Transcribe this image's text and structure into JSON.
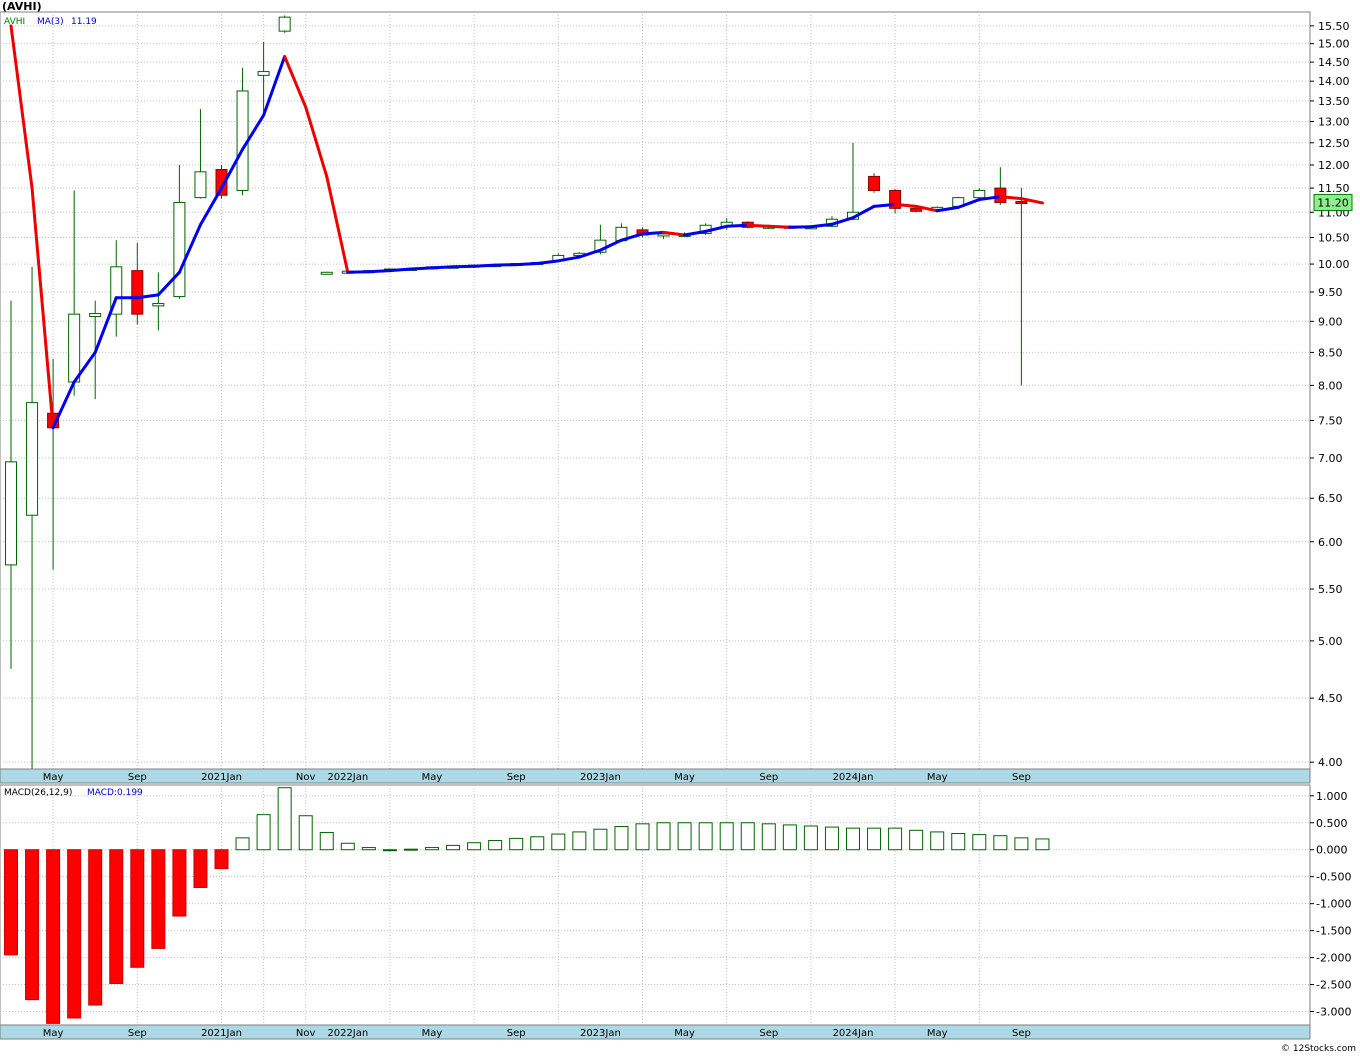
{
  "chart_data": [
    {
      "type": "candlestick",
      "title": "(AVHI)",
      "legend": [
        {
          "label": "AVHI",
          "color": "#008000"
        },
        {
          "label": "MA(3)",
          "color": "#0000cc"
        },
        {
          "label": "11.19",
          "color": "#0000cc"
        }
      ],
      "last_price": "11.20",
      "scale": "log",
      "ylim": [
        3.95,
        15.9
      ],
      "yticks": [
        "15.50",
        "15.00",
        "14.50",
        "14.00",
        "13.50",
        "13.00",
        "12.50",
        "12.00",
        "11.50",
        "11.00",
        "10.50",
        "10.00",
        "9.50",
        "9.00",
        "8.50",
        "8.00",
        "7.50",
        "7.00",
        "6.50",
        "6.00",
        "5.50",
        "5.00",
        "4.50",
        "4.00"
      ],
      "x_month_index_range": [
        -0.5,
        51.5
      ],
      "month_gridlines": [
        2,
        6,
        10,
        12,
        14,
        18,
        22,
        26,
        30,
        34,
        38,
        42,
        46
      ],
      "xtick_labels": [
        {
          "month": 2,
          "label": "May"
        },
        {
          "month": 6,
          "label": "Sep"
        },
        {
          "month": 10,
          "label": "2021Jan"
        },
        {
          "month": 14,
          "label": "Nov"
        },
        {
          "month": 16,
          "label": "2022Jan"
        },
        {
          "month": 20,
          "label": "May"
        },
        {
          "month": 24,
          "label": "Sep"
        },
        {
          "month": 28,
          "label": "2023Jan"
        },
        {
          "month": 32,
          "label": "May"
        },
        {
          "month": 36,
          "label": "Sep"
        },
        {
          "month": 40,
          "label": "2024Jan"
        },
        {
          "month": 44,
          "label": "May"
        },
        {
          "month": 48,
          "label": "Sep"
        }
      ],
      "candles": [
        {
          "m": 0,
          "o": 5.75,
          "h": 9.35,
          "l": 4.75,
          "c": 6.95
        },
        {
          "m": 1,
          "o": 6.3,
          "h": 9.95,
          "l": 3.95,
          "c": 7.75
        },
        {
          "m": 2,
          "o": 7.6,
          "h": 8.4,
          "l": 5.7,
          "c": 7.4
        },
        {
          "m": 3,
          "o": 8.05,
          "h": 11.45,
          "l": 7.85,
          "c": 9.12
        },
        {
          "m": 4,
          "o": 9.08,
          "h": 9.35,
          "l": 7.8,
          "c": 9.13
        },
        {
          "m": 5,
          "o": 9.12,
          "h": 10.45,
          "l": 8.75,
          "c": 9.95
        },
        {
          "m": 6,
          "o": 9.88,
          "h": 10.4,
          "l": 8.95,
          "c": 9.12
        },
        {
          "m": 7,
          "o": 9.26,
          "h": 9.85,
          "l": 8.85,
          "c": 9.3
        },
        {
          "m": 8,
          "o": 9.42,
          "h": 12.0,
          "l": 9.38,
          "c": 11.2
        },
        {
          "m": 9,
          "o": 11.3,
          "h": 13.3,
          "l": 11.28,
          "c": 11.85
        },
        {
          "m": 10,
          "o": 11.9,
          "h": 12.0,
          "l": 11.28,
          "c": 11.35
        },
        {
          "m": 11,
          "o": 11.45,
          "h": 14.35,
          "l": 11.35,
          "c": 13.75
        },
        {
          "m": 12,
          "o": 14.15,
          "h": 15.05,
          "l": 13.2,
          "c": 14.25
        },
        {
          "m": 13,
          "o": 15.35,
          "h": 15.8,
          "l": 15.3,
          "c": 15.75
        },
        {
          "m": 14,
          "o": null,
          "h": null,
          "l": null,
          "c": null
        },
        {
          "m": 15,
          "o": 9.84,
          "h": 9.86,
          "l": 9.83,
          "c": 9.85
        },
        {
          "m": 16,
          "o": 9.86,
          "h": 9.88,
          "l": 9.84,
          "c": 9.87
        },
        {
          "m": 17,
          "o": 9.87,
          "h": 9.89,
          "l": 9.85,
          "c": 9.88
        },
        {
          "m": 18,
          "o": 9.9,
          "h": 9.92,
          "l": 9.88,
          "c": 9.91
        },
        {
          "m": 19,
          "o": 9.91,
          "h": 9.93,
          "l": 9.89,
          "c": 9.92
        },
        {
          "m": 20,
          "o": 9.93,
          "h": 9.96,
          "l": 9.91,
          "c": 9.95
        },
        {
          "m": 21,
          "o": 9.95,
          "h": 9.97,
          "l": 9.94,
          "c": 9.96
        },
        {
          "m": 22,
          "o": 9.97,
          "h": 9.99,
          "l": 9.95,
          "c": 9.98
        },
        {
          "m": 23,
          "o": 9.98,
          "h": 10.0,
          "l": 9.97,
          "c": 9.99
        },
        {
          "m": 24,
          "o": 10.0,
          "h": 10.02,
          "l": 9.99,
          "c": 10.01
        },
        {
          "m": 25,
          "o": 10.02,
          "h": 10.04,
          "l": 10.0,
          "c": 10.03
        },
        {
          "m": 26,
          "o": 10.06,
          "h": 10.2,
          "l": 10.05,
          "c": 10.16
        },
        {
          "m": 27,
          "o": 10.16,
          "h": 10.22,
          "l": 10.14,
          "c": 10.2
        },
        {
          "m": 28,
          "o": 10.22,
          "h": 10.75,
          "l": 10.18,
          "c": 10.45
        },
        {
          "m": 29,
          "o": 10.44,
          "h": 10.78,
          "l": 10.42,
          "c": 10.7
        },
        {
          "m": 30,
          "o": 10.65,
          "h": 10.7,
          "l": 10.5,
          "c": 10.55
        },
        {
          "m": 31,
          "o": 10.55,
          "h": 10.62,
          "l": 10.47,
          "c": 10.57
        },
        {
          "m": 32,
          "o": 10.55,
          "h": 10.6,
          "l": 10.52,
          "c": 10.56
        },
        {
          "m": 33,
          "o": 10.58,
          "h": 10.78,
          "l": 10.55,
          "c": 10.74
        },
        {
          "m": 34,
          "o": 10.72,
          "h": 10.88,
          "l": 10.65,
          "c": 10.8
        },
        {
          "m": 35,
          "o": 10.8,
          "h": 10.82,
          "l": 10.68,
          "c": 10.7
        },
        {
          "m": 36,
          "o": 10.7,
          "h": 10.74,
          "l": 10.67,
          "c": 10.72
        },
        {
          "m": 37,
          "o": 10.72,
          "h": 10.74,
          "l": 10.68,
          "c": 10.7
        },
        {
          "m": 38,
          "o": 10.7,
          "h": 10.72,
          "l": 10.68,
          "c": 10.71
        },
        {
          "m": 39,
          "o": 10.72,
          "h": 10.92,
          "l": 10.7,
          "c": 10.86
        },
        {
          "m": 40,
          "o": 10.86,
          "h": 12.5,
          "l": 10.84,
          "c": 11.0
        },
        {
          "m": 41,
          "o": 11.75,
          "h": 11.82,
          "l": 11.4,
          "c": 11.45
        },
        {
          "m": 42,
          "o": 11.45,
          "h": 11.48,
          "l": 10.98,
          "c": 11.08
        },
        {
          "m": 43,
          "o": 11.08,
          "h": 11.12,
          "l": 11.0,
          "c": 11.02
        },
        {
          "m": 44,
          "o": 11.08,
          "h": 11.12,
          "l": 11.05,
          "c": 11.1
        },
        {
          "m": 45,
          "o": 11.12,
          "h": 11.32,
          "l": 11.1,
          "c": 11.3
        },
        {
          "m": 46,
          "o": 11.3,
          "h": 11.5,
          "l": 11.28,
          "c": 11.45
        },
        {
          "m": 47,
          "o": 11.5,
          "h": 11.95,
          "l": 11.15,
          "c": 11.2
        },
        {
          "m": 48,
          "o": 11.22,
          "h": 11.5,
          "l": 8.0,
          "c": 11.2
        },
        {
          "m": 49,
          "o": null,
          "h": null,
          "l": null,
          "c": null
        }
      ],
      "ma3": [
        {
          "m": 0,
          "v": 15.5,
          "dir": "down"
        },
        {
          "m": 1,
          "v": 11.5,
          "dir": "down"
        },
        {
          "m": 2,
          "v": 7.4,
          "dir": "up"
        },
        {
          "m": 3,
          "v": 8.05,
          "dir": "up"
        },
        {
          "m": 4,
          "v": 8.5,
          "dir": "up"
        },
        {
          "m": 5,
          "v": 9.4,
          "dir": "up"
        },
        {
          "m": 6,
          "v": 9.4,
          "dir": "up"
        },
        {
          "m": 7,
          "v": 9.45,
          "dir": "up"
        },
        {
          "m": 8,
          "v": 9.85,
          "dir": "up"
        },
        {
          "m": 9,
          "v": 10.75,
          "dir": "up"
        },
        {
          "m": 10,
          "v": 11.5,
          "dir": "up"
        },
        {
          "m": 11,
          "v": 12.35,
          "dir": "up"
        },
        {
          "m": 12,
          "v": 13.15,
          "dir": "up"
        },
        {
          "m": 13,
          "v": 14.65,
          "dir": "down"
        },
        {
          "m": 14,
          "v": 13.35,
          "dir": "down"
        },
        {
          "m": 15,
          "v": 11.75,
          "dir": "down"
        },
        {
          "m": 16,
          "v": 9.85,
          "dir": "up"
        },
        {
          "m": 17,
          "v": 9.86,
          "dir": "up"
        },
        {
          "m": 18,
          "v": 9.88,
          "dir": "up"
        },
        {
          "m": 19,
          "v": 9.91,
          "dir": "up"
        },
        {
          "m": 20,
          "v": 9.93,
          "dir": "up"
        },
        {
          "m": 21,
          "v": 9.95,
          "dir": "up"
        },
        {
          "m": 22,
          "v": 9.96,
          "dir": "up"
        },
        {
          "m": 23,
          "v": 9.98,
          "dir": "up"
        },
        {
          "m": 24,
          "v": 9.99,
          "dir": "up"
        },
        {
          "m": 25,
          "v": 10.01,
          "dir": "up"
        },
        {
          "m": 26,
          "v": 10.06,
          "dir": "up"
        },
        {
          "m": 27,
          "v": 10.13,
          "dir": "up"
        },
        {
          "m": 28,
          "v": 10.26,
          "dir": "up"
        },
        {
          "m": 29,
          "v": 10.45,
          "dir": "up"
        },
        {
          "m": 30,
          "v": 10.57,
          "dir": "up"
        },
        {
          "m": 31,
          "v": 10.6,
          "dir": "down"
        },
        {
          "m": 32,
          "v": 10.55,
          "dir": "up"
        },
        {
          "m": 33,
          "v": 10.62,
          "dir": "up"
        },
        {
          "m": 34,
          "v": 10.72,
          "dir": "up"
        },
        {
          "m": 35,
          "v": 10.74,
          "dir": "down"
        },
        {
          "m": 36,
          "v": 10.72,
          "dir": "down"
        },
        {
          "m": 37,
          "v": 10.7,
          "dir": "up"
        },
        {
          "m": 38,
          "v": 10.71,
          "dir": "up"
        },
        {
          "m": 39,
          "v": 10.76,
          "dir": "up"
        },
        {
          "m": 40,
          "v": 10.89,
          "dir": "up"
        },
        {
          "m": 41,
          "v": 11.12,
          "dir": "up"
        },
        {
          "m": 42,
          "v": 11.16,
          "dir": "down"
        },
        {
          "m": 43,
          "v": 11.12,
          "dir": "down"
        },
        {
          "m": 44,
          "v": 11.03,
          "dir": "up"
        },
        {
          "m": 45,
          "v": 11.1,
          "dir": "up"
        },
        {
          "m": 46,
          "v": 11.26,
          "dir": "up"
        },
        {
          "m": 47,
          "v": 11.32,
          "dir": "down"
        },
        {
          "m": 48,
          "v": 11.28,
          "dir": "down"
        },
        {
          "m": 49,
          "v": 11.19,
          "dir": "down"
        }
      ]
    },
    {
      "type": "bar",
      "title": "MACD(26,12,9)",
      "legend": [
        {
          "label": "MACD(26,12,9)",
          "color": "#000000"
        },
        {
          "label": "MACD:0.199",
          "color": "#0000cc"
        }
      ],
      "ylim": [
        -3.25,
        1.2
      ],
      "yticks": [
        "1.000",
        "0.500",
        "0.000",
        "-0.500",
        "-1.000",
        "-1.500",
        "-2.000",
        "-2.500",
        "-3.000"
      ],
      "x": [
        0,
        1,
        2,
        3,
        4,
        5,
        6,
        7,
        8,
        9,
        10,
        11,
        12,
        13,
        14,
        15,
        16,
        17,
        18,
        19,
        20,
        21,
        22,
        23,
        24,
        25,
        26,
        27,
        28,
        29,
        30,
        31,
        32,
        33,
        34,
        35,
        36,
        37,
        38,
        39,
        40,
        41,
        42,
        43,
        44,
        45,
        46,
        47,
        48,
        49
      ],
      "values": [
        -1.95,
        -2.78,
        -3.22,
        -3.12,
        -2.88,
        -2.48,
        -2.18,
        -1.83,
        -1.23,
        -0.7,
        -0.35,
        0.22,
        0.65,
        1.15,
        0.63,
        0.32,
        0.12,
        0.04,
        0.0,
        0.01,
        0.04,
        0.08,
        0.13,
        0.17,
        0.21,
        0.24,
        0.29,
        0.33,
        0.38,
        0.43,
        0.48,
        0.5,
        0.5,
        0.5,
        0.5,
        0.5,
        0.48,
        0.46,
        0.44,
        0.42,
        0.4,
        0.4,
        0.4,
        0.36,
        0.33,
        0.3,
        0.28,
        0.26,
        0.22,
        0.2,
        0.199
      ]
    }
  ],
  "credit": "© 12Stocks.com"
}
